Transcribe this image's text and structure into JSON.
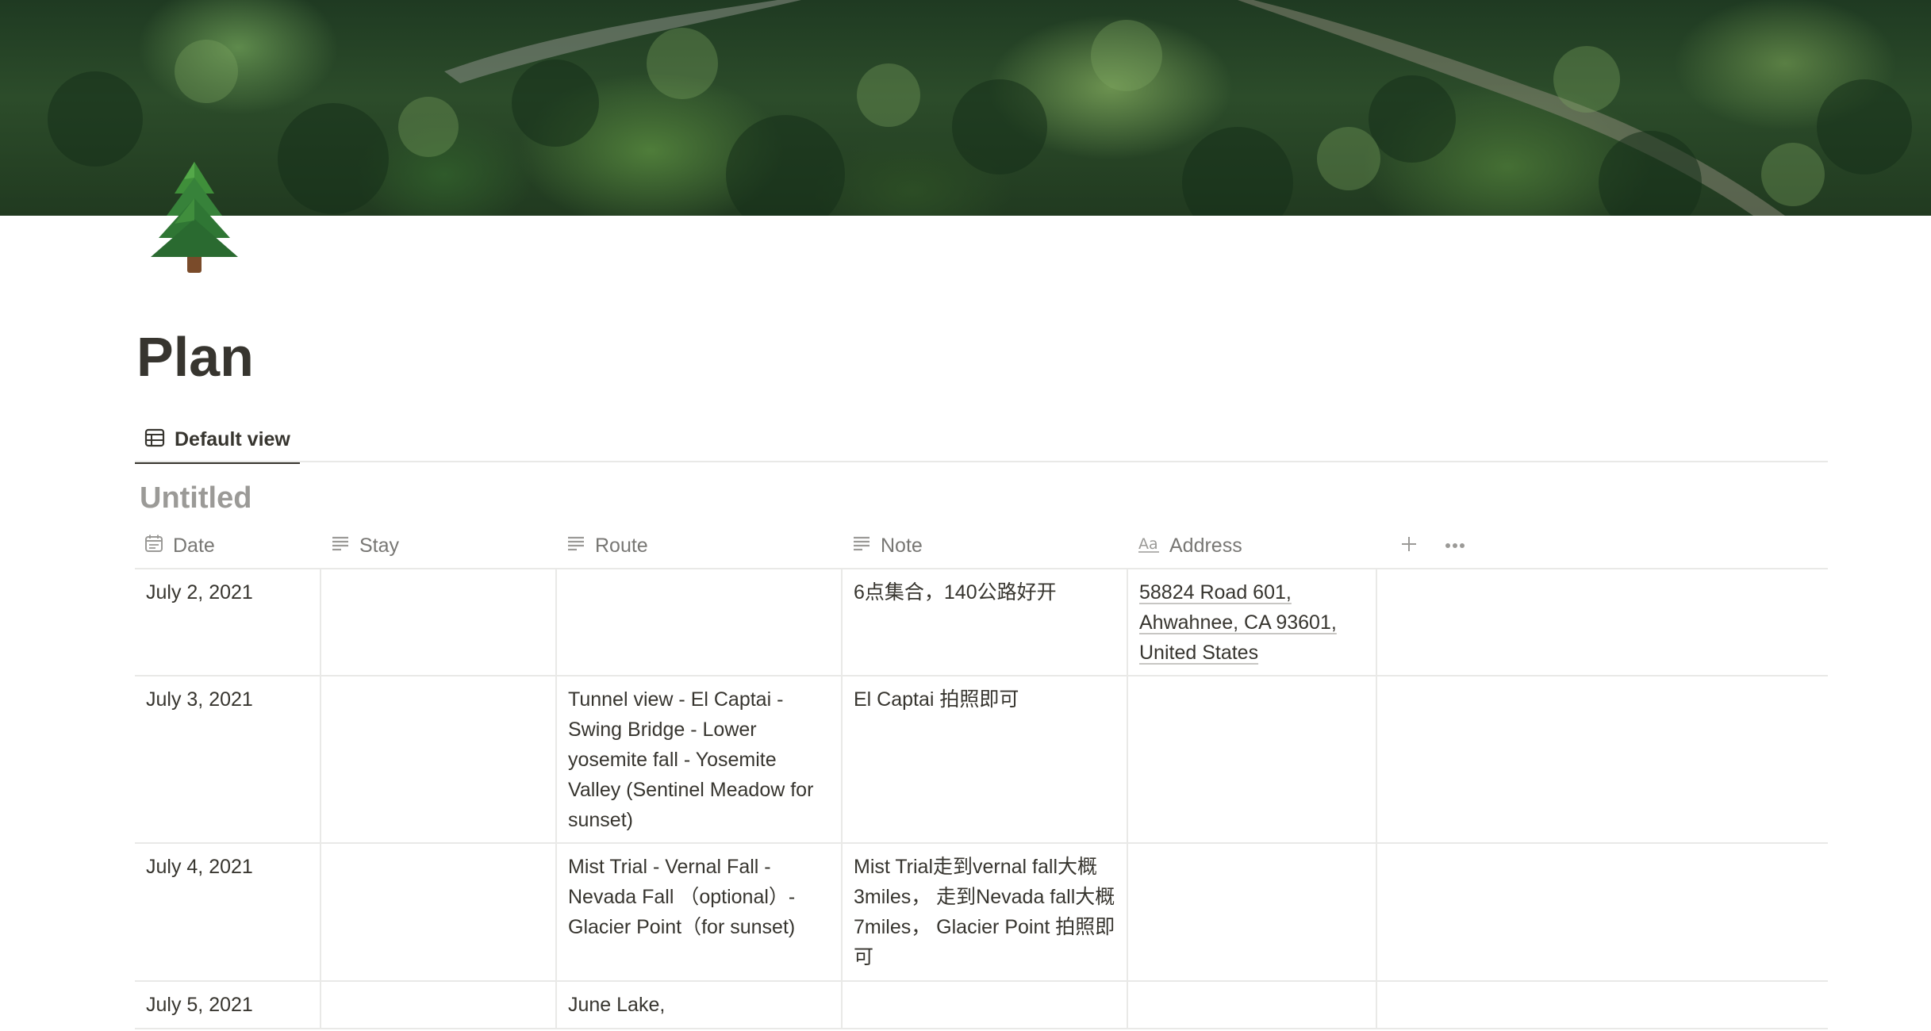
{
  "page": {
    "title": "Plan",
    "icon": "evergreen-tree-icon",
    "cover": "forest-aerial-cover"
  },
  "view_tabs": [
    {
      "label": "Default view",
      "icon": "table-icon",
      "active": true
    }
  ],
  "database": {
    "title": "Untitled",
    "columns": [
      {
        "name": "Date",
        "icon": "calendar-icon"
      },
      {
        "name": "Stay",
        "icon": "text-lines-icon"
      },
      {
        "name": "Route",
        "icon": "text-lines-icon"
      },
      {
        "name": "Note",
        "icon": "text-lines-icon"
      },
      {
        "name": "Address",
        "icon": "title-aa-icon"
      }
    ],
    "actions": [
      {
        "name": "add-property",
        "icon": "plus-icon"
      },
      {
        "name": "more-options",
        "icon": "ellipsis-icon"
      }
    ],
    "rows": [
      {
        "date": "July 2, 2021",
        "stay": "",
        "route": "",
        "note": "6点集合，140公路好开",
        "address": "58824 Road 601, Ahwahnee, CA 93601, United States"
      },
      {
        "date": "July 3, 2021",
        "stay": "",
        "route": "Tunnel view - El Captai - Swing Bridge - Lower yosemite fall - Yosemite Valley (Sentinel Meadow for sunset)",
        "note": " El Captai 拍照即可",
        "address": ""
      },
      {
        "date": "July 4, 2021",
        "stay": "",
        "route": "Mist Trial - Vernal Fall - Nevada Fall （optional）- Glacier Point（for sunset)",
        "note": "Mist Trial走到vernal fall大概3miles， 走到Nevada fall大概7miles， Glacier Point 拍照即可",
        "address": ""
      },
      {
        "date": "July 5, 2021",
        "stay": "",
        "route": "June Lake,",
        "note": "",
        "address": ""
      }
    ]
  },
  "colors": {
    "text": "#37352f",
    "muted": "#787774",
    "divider": "#e9e9e7",
    "title_muted": "#9b9a97"
  }
}
